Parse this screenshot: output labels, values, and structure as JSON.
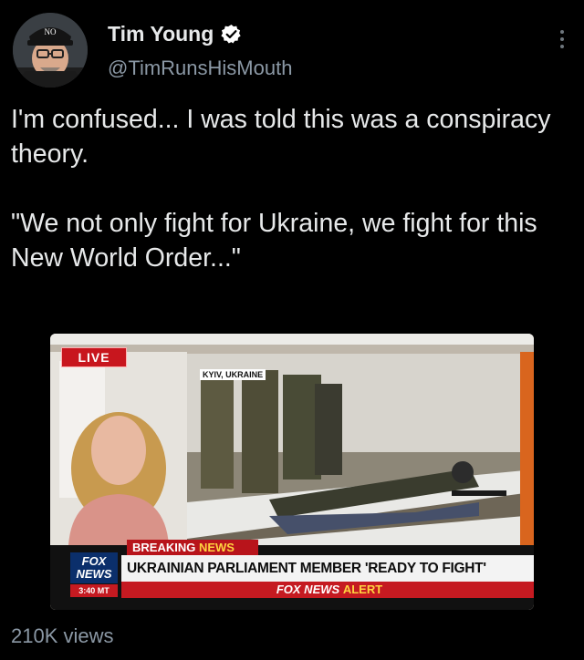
{
  "author": {
    "name": "Tim Young",
    "handle": "@TimRunsHisMouth",
    "hat_text": "NO"
  },
  "tweet": {
    "text_line1": "I'm confused... I was told this was a conspiracy theory.",
    "text_line2": "\"We not only fight for Ukraine, we fight for this New World Order...\""
  },
  "media": {
    "live_label": "LIVE",
    "location": "KYIV, UKRAINE",
    "breaking_label_a": "BREAKING",
    "breaking_label_b": "NEWS",
    "headline": "UKRAINIAN PARLIAMENT MEMBER 'READY TO FIGHT'",
    "alert_prefix": "FOX NEWS",
    "alert_word": "ALERT",
    "logo_line1": "FOX",
    "logo_line2": "NEWS",
    "time": "3:40 MT"
  },
  "stats": {
    "views": "210K views"
  },
  "colors": {
    "background": "#000000",
    "text": "#e7e9ea",
    "secondary": "#8b98a5",
    "verified_badge": "#ffffff",
    "fox_red": "#c51a21",
    "fox_blue": "#0b2f6b"
  },
  "icons": {
    "verified": "verified-badge-icon",
    "more": "more-options-icon"
  }
}
